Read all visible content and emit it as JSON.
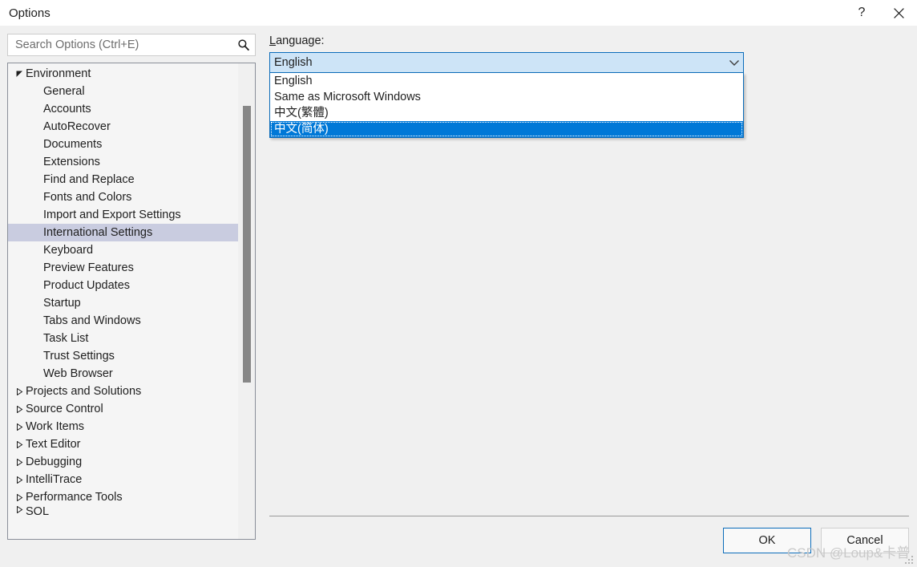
{
  "window": {
    "title": "Options",
    "help_label": "?",
    "close_label": "✕"
  },
  "search": {
    "placeholder": "Search Options (Ctrl+E)",
    "value": "",
    "icon": "search-icon"
  },
  "tree": {
    "items": [
      {
        "label": "Environment",
        "level": 0,
        "expander": "expanded",
        "selected": false
      },
      {
        "label": "General",
        "level": 1,
        "expander": "none",
        "selected": false
      },
      {
        "label": "Accounts",
        "level": 1,
        "expander": "none",
        "selected": false
      },
      {
        "label": "AutoRecover",
        "level": 1,
        "expander": "none",
        "selected": false
      },
      {
        "label": "Documents",
        "level": 1,
        "expander": "none",
        "selected": false
      },
      {
        "label": "Extensions",
        "level": 1,
        "expander": "none",
        "selected": false
      },
      {
        "label": "Find and Replace",
        "level": 1,
        "expander": "none",
        "selected": false
      },
      {
        "label": "Fonts and Colors",
        "level": 1,
        "expander": "none",
        "selected": false
      },
      {
        "label": "Import and Export Settings",
        "level": 1,
        "expander": "none",
        "selected": false
      },
      {
        "label": "International Settings",
        "level": 1,
        "expander": "none",
        "selected": true
      },
      {
        "label": "Keyboard",
        "level": 1,
        "expander": "none",
        "selected": false
      },
      {
        "label": "Preview Features",
        "level": 1,
        "expander": "none",
        "selected": false
      },
      {
        "label": "Product Updates",
        "level": 1,
        "expander": "none",
        "selected": false
      },
      {
        "label": "Startup",
        "level": 1,
        "expander": "none",
        "selected": false
      },
      {
        "label": "Tabs and Windows",
        "level": 1,
        "expander": "none",
        "selected": false
      },
      {
        "label": "Task List",
        "level": 1,
        "expander": "none",
        "selected": false
      },
      {
        "label": "Trust Settings",
        "level": 1,
        "expander": "none",
        "selected": false
      },
      {
        "label": "Web Browser",
        "level": 1,
        "expander": "none",
        "selected": false
      },
      {
        "label": "Projects and Solutions",
        "level": 0,
        "expander": "collapsed",
        "selected": false
      },
      {
        "label": "Source Control",
        "level": 0,
        "expander": "collapsed",
        "selected": false
      },
      {
        "label": "Work Items",
        "level": 0,
        "expander": "collapsed",
        "selected": false
      },
      {
        "label": "Text Editor",
        "level": 0,
        "expander": "collapsed",
        "selected": false
      },
      {
        "label": "Debugging",
        "level": 0,
        "expander": "collapsed",
        "selected": false
      },
      {
        "label": "IntelliTrace",
        "level": 0,
        "expander": "collapsed",
        "selected": false
      },
      {
        "label": "Performance Tools",
        "level": 0,
        "expander": "collapsed",
        "selected": false
      },
      {
        "label": "SQL",
        "level": 0,
        "expander": "collapsed",
        "selected": false,
        "clipped": true
      }
    ]
  },
  "language_section": {
    "label": "Language:",
    "label_accel": "L",
    "label_rest": "anguage:",
    "selected_value": "English",
    "options": [
      {
        "label": "English",
        "highlighted": false
      },
      {
        "label": "Same as Microsoft Windows",
        "highlighted": false
      },
      {
        "label": "中文(繁體)",
        "highlighted": false
      },
      {
        "label": "中文(简体)",
        "highlighted": true
      }
    ]
  },
  "footer": {
    "ok_label": "OK",
    "cancel_label": "Cancel"
  },
  "watermark": {
    "text": "CSDN @Loup&卡普"
  },
  "colors": {
    "accent": "#0078d7",
    "combo_border": "#0b6cba",
    "combo_fill": "#cde4f7",
    "tree_selection": "#c9cce0",
    "dialog_bg": "#f0f0f0"
  }
}
